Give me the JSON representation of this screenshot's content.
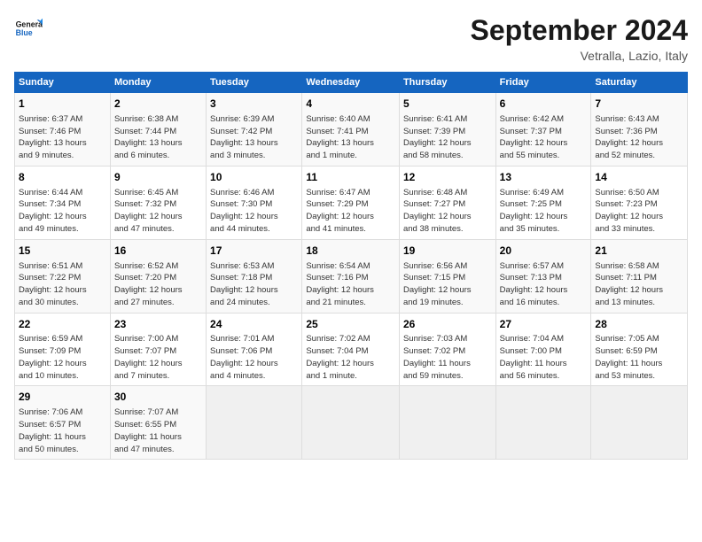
{
  "header": {
    "logo_general": "General",
    "logo_blue": "Blue",
    "month": "September 2024",
    "location": "Vetralla, Lazio, Italy"
  },
  "days_of_week": [
    "Sunday",
    "Monday",
    "Tuesday",
    "Wednesday",
    "Thursday",
    "Friday",
    "Saturday"
  ],
  "weeks": [
    [
      {
        "day": "1",
        "info": "Sunrise: 6:37 AM\nSunset: 7:46 PM\nDaylight: 13 hours\nand 9 minutes."
      },
      {
        "day": "2",
        "info": "Sunrise: 6:38 AM\nSunset: 7:44 PM\nDaylight: 13 hours\nand 6 minutes."
      },
      {
        "day": "3",
        "info": "Sunrise: 6:39 AM\nSunset: 7:42 PM\nDaylight: 13 hours\nand 3 minutes."
      },
      {
        "day": "4",
        "info": "Sunrise: 6:40 AM\nSunset: 7:41 PM\nDaylight: 13 hours\nand 1 minute."
      },
      {
        "day": "5",
        "info": "Sunrise: 6:41 AM\nSunset: 7:39 PM\nDaylight: 12 hours\nand 58 minutes."
      },
      {
        "day": "6",
        "info": "Sunrise: 6:42 AM\nSunset: 7:37 PM\nDaylight: 12 hours\nand 55 minutes."
      },
      {
        "day": "7",
        "info": "Sunrise: 6:43 AM\nSunset: 7:36 PM\nDaylight: 12 hours\nand 52 minutes."
      }
    ],
    [
      {
        "day": "8",
        "info": "Sunrise: 6:44 AM\nSunset: 7:34 PM\nDaylight: 12 hours\nand 49 minutes."
      },
      {
        "day": "9",
        "info": "Sunrise: 6:45 AM\nSunset: 7:32 PM\nDaylight: 12 hours\nand 47 minutes."
      },
      {
        "day": "10",
        "info": "Sunrise: 6:46 AM\nSunset: 7:30 PM\nDaylight: 12 hours\nand 44 minutes."
      },
      {
        "day": "11",
        "info": "Sunrise: 6:47 AM\nSunset: 7:29 PM\nDaylight: 12 hours\nand 41 minutes."
      },
      {
        "day": "12",
        "info": "Sunrise: 6:48 AM\nSunset: 7:27 PM\nDaylight: 12 hours\nand 38 minutes."
      },
      {
        "day": "13",
        "info": "Sunrise: 6:49 AM\nSunset: 7:25 PM\nDaylight: 12 hours\nand 35 minutes."
      },
      {
        "day": "14",
        "info": "Sunrise: 6:50 AM\nSunset: 7:23 PM\nDaylight: 12 hours\nand 33 minutes."
      }
    ],
    [
      {
        "day": "15",
        "info": "Sunrise: 6:51 AM\nSunset: 7:22 PM\nDaylight: 12 hours\nand 30 minutes."
      },
      {
        "day": "16",
        "info": "Sunrise: 6:52 AM\nSunset: 7:20 PM\nDaylight: 12 hours\nand 27 minutes."
      },
      {
        "day": "17",
        "info": "Sunrise: 6:53 AM\nSunset: 7:18 PM\nDaylight: 12 hours\nand 24 minutes."
      },
      {
        "day": "18",
        "info": "Sunrise: 6:54 AM\nSunset: 7:16 PM\nDaylight: 12 hours\nand 21 minutes."
      },
      {
        "day": "19",
        "info": "Sunrise: 6:56 AM\nSunset: 7:15 PM\nDaylight: 12 hours\nand 19 minutes."
      },
      {
        "day": "20",
        "info": "Sunrise: 6:57 AM\nSunset: 7:13 PM\nDaylight: 12 hours\nand 16 minutes."
      },
      {
        "day": "21",
        "info": "Sunrise: 6:58 AM\nSunset: 7:11 PM\nDaylight: 12 hours\nand 13 minutes."
      }
    ],
    [
      {
        "day": "22",
        "info": "Sunrise: 6:59 AM\nSunset: 7:09 PM\nDaylight: 12 hours\nand 10 minutes."
      },
      {
        "day": "23",
        "info": "Sunrise: 7:00 AM\nSunset: 7:07 PM\nDaylight: 12 hours\nand 7 minutes."
      },
      {
        "day": "24",
        "info": "Sunrise: 7:01 AM\nSunset: 7:06 PM\nDaylight: 12 hours\nand 4 minutes."
      },
      {
        "day": "25",
        "info": "Sunrise: 7:02 AM\nSunset: 7:04 PM\nDaylight: 12 hours\nand 1 minute."
      },
      {
        "day": "26",
        "info": "Sunrise: 7:03 AM\nSunset: 7:02 PM\nDaylight: 11 hours\nand 59 minutes."
      },
      {
        "day": "27",
        "info": "Sunrise: 7:04 AM\nSunset: 7:00 PM\nDaylight: 11 hours\nand 56 minutes."
      },
      {
        "day": "28",
        "info": "Sunrise: 7:05 AM\nSunset: 6:59 PM\nDaylight: 11 hours\nand 53 minutes."
      }
    ],
    [
      {
        "day": "29",
        "info": "Sunrise: 7:06 AM\nSunset: 6:57 PM\nDaylight: 11 hours\nand 50 minutes."
      },
      {
        "day": "30",
        "info": "Sunrise: 7:07 AM\nSunset: 6:55 PM\nDaylight: 11 hours\nand 47 minutes."
      },
      null,
      null,
      null,
      null,
      null
    ]
  ]
}
